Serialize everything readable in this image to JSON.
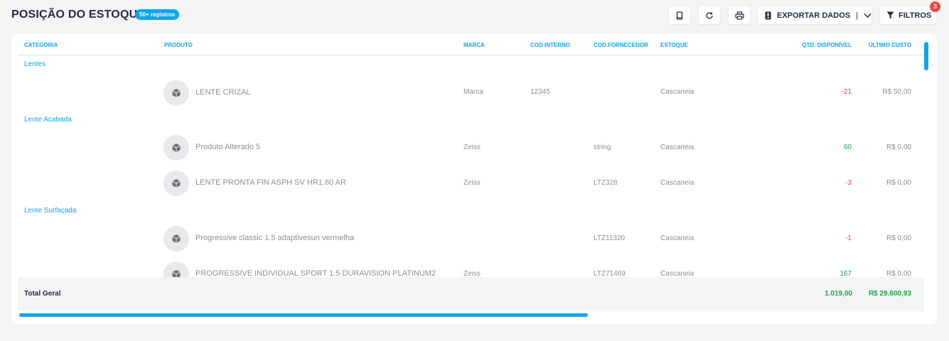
{
  "header": {
    "title": "POSIÇÃO DO ESTOQUE",
    "records_badge": "50+ registros",
    "export_label": "EXPORTAR DADOS",
    "export_separator": "|",
    "filters_label": "FILTROS",
    "filters_count": "3"
  },
  "columns": {
    "categoria": "CATEGORIA",
    "produto": "PRODUTO",
    "marca": "MARCA",
    "cod_interno": "COD.INTERNO",
    "cod_fornecedor": "COD.FORNECEDOR",
    "estoque": "ESTOQUE",
    "qtd_disponivel": "QTD. DISPONÍVEL",
    "ultimo_custo": "ÚLTIMO CUSTO"
  },
  "groups": [
    {
      "category": "Lentes"
    },
    {
      "category": "Lente Acabada"
    },
    {
      "category": "Lente Surfaçada"
    }
  ],
  "rows": [
    {
      "produto": "LENTE CRIZAL",
      "marca": "Marca",
      "cod_interno": "12345",
      "cod_fornecedor": "",
      "estoque": "Cascaneia",
      "qtd": "-21",
      "custo": "R$ 50,00"
    },
    {
      "produto": "Produto Alterado 5",
      "marca": "Zeiss",
      "cod_interno": "",
      "cod_fornecedor": "string",
      "estoque": "Cascaneia",
      "qtd": "60",
      "custo": "R$ 0,00"
    },
    {
      "produto": "LENTE PRONTA FIN ASPH SV HR1.60 AR",
      "marca": "Zeiss",
      "cod_interno": "",
      "cod_fornecedor": "LTZ328",
      "estoque": "Cascaneia",
      "qtd": "-3",
      "custo": "R$ 0,00"
    },
    {
      "produto": "Progressive classic 1.5 adaptivesun vermelha",
      "marca": "",
      "cod_interno": "",
      "cod_fornecedor": "LTZ11320",
      "estoque": "Cascaneia",
      "qtd": "-1",
      "custo": "R$ 0,00"
    },
    {
      "produto": "PROGRESSIVE INDIVIDUAL SPORT 1.5 DURAVISION PLATINUM2",
      "marca": "Zeiss",
      "cod_interno": "",
      "cod_fornecedor": "LTZ71469",
      "estoque": "Cascaneia",
      "qtd": "167",
      "custo": "R$ 0,00"
    }
  ],
  "totals": {
    "label": "Total Geral",
    "qtd": "1.019,00",
    "custo": "R$ 29.600,93"
  },
  "colors": {
    "accent": "#0ea5e9",
    "negative": "#ef4444",
    "positive": "#22a04b",
    "title": "#1f2a44"
  },
  "icons": {
    "book": "book-icon",
    "refresh": "refresh-icon",
    "print": "printer-icon",
    "export": "file-export-icon",
    "dropdown": "chevron-down-icon",
    "filter": "filter-icon",
    "product": "box-icon"
  }
}
